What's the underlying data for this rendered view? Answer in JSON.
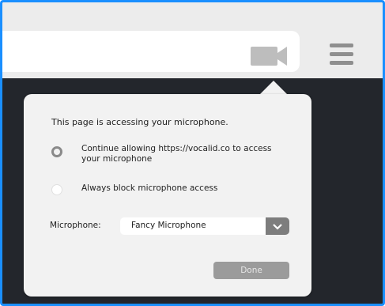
{
  "popup": {
    "title": "This page is accessing your microphone.",
    "options": [
      {
        "label": "Continue allowing https://vocalid.co to access your microphone",
        "selected": true
      },
      {
        "label": "Always block microphone access",
        "selected": false
      }
    ],
    "microphone_label": "Microphone:",
    "microphone_value": "Fancy Microphone",
    "done_label": "Done"
  },
  "icons": {
    "camera": "video-camera-icon",
    "menu": "hamburger-menu-icon",
    "dropdown": "chevron-down-icon"
  },
  "colors": {
    "frame_border": "#1a8fff",
    "page_background": "#23262c",
    "toolbar": "#ececec",
    "popup_background": "#f2f2f2",
    "done_button": "#9b9b9b"
  }
}
